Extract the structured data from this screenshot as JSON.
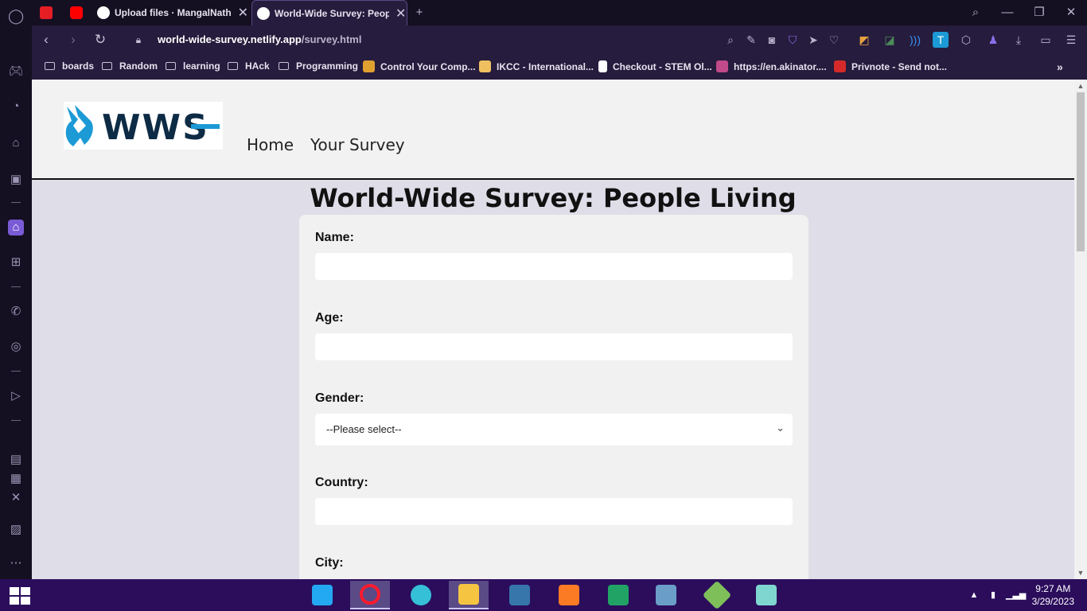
{
  "browser": {
    "tabs": [
      {
        "title": "",
        "favicon": "am-icon",
        "color": "#e51e25"
      },
      {
        "title": "",
        "favicon": "youtube-icon",
        "color": "#ff0000"
      },
      {
        "title": "Upload files · MangalNathYa",
        "favicon": "github-icon",
        "color": "#ffffff"
      },
      {
        "title": "World-Wide Survey: People",
        "favicon": "globe-icon",
        "color": "#ffffff"
      }
    ],
    "url_host": "world-wide-survey.netlify.app",
    "url_path": "/survey.html",
    "bookmarks": [
      {
        "label": "boards",
        "type": "folder"
      },
      {
        "label": "Random",
        "type": "folder"
      },
      {
        "label": "learning",
        "type": "folder"
      },
      {
        "label": "HAck",
        "type": "folder"
      },
      {
        "label": "Programming",
        "type": "folder"
      },
      {
        "label": "Control Your Comp...",
        "type": "site",
        "color": "#e0a030"
      },
      {
        "label": "IKCC - International...",
        "type": "site",
        "color": "#f0c060"
      },
      {
        "label": "Checkout - STEM Ol...",
        "type": "page",
        "color": "#ffffff"
      },
      {
        "label": "https://en.akinator....",
        "type": "site",
        "color": "#c04a8a"
      },
      {
        "label": "Privnote - Send not...",
        "type": "site",
        "color": "#d62a2a"
      }
    ]
  },
  "site": {
    "logo_text": "WWS",
    "nav": [
      "Home",
      "Your Survey"
    ],
    "title": "World-Wide Survey: People Living",
    "fields": {
      "name_label": "Name:",
      "age_label": "Age:",
      "gender_label": "Gender:",
      "gender_selected": "--Please select--",
      "country_label": "Country:",
      "city_label": "City:"
    }
  },
  "taskbar": {
    "time": "9:27 AM",
    "date": "3/29/2023",
    "apps": [
      {
        "name": "vscode",
        "color": "#23a9f2"
      },
      {
        "name": "opera",
        "color": "#ff1b2d"
      },
      {
        "name": "edge",
        "color": "#35c0d8"
      },
      {
        "name": "file-explorer",
        "color": "#f5c542"
      },
      {
        "name": "python",
        "color": "#3776ab"
      },
      {
        "name": "xampp",
        "color": "#fb7a24"
      },
      {
        "name": "excel-store",
        "color": "#21a366"
      },
      {
        "name": "virtualbox",
        "color": "#6a9ec8"
      },
      {
        "name": "git-kraken",
        "color": "#7fbf5a"
      },
      {
        "name": "notes-app",
        "color": "#7fd6d0"
      }
    ]
  },
  "colors": {
    "accent": "#7a5bd6",
    "logo_blue": "#1c9ad6",
    "logo_navy": "#0d2b45"
  }
}
